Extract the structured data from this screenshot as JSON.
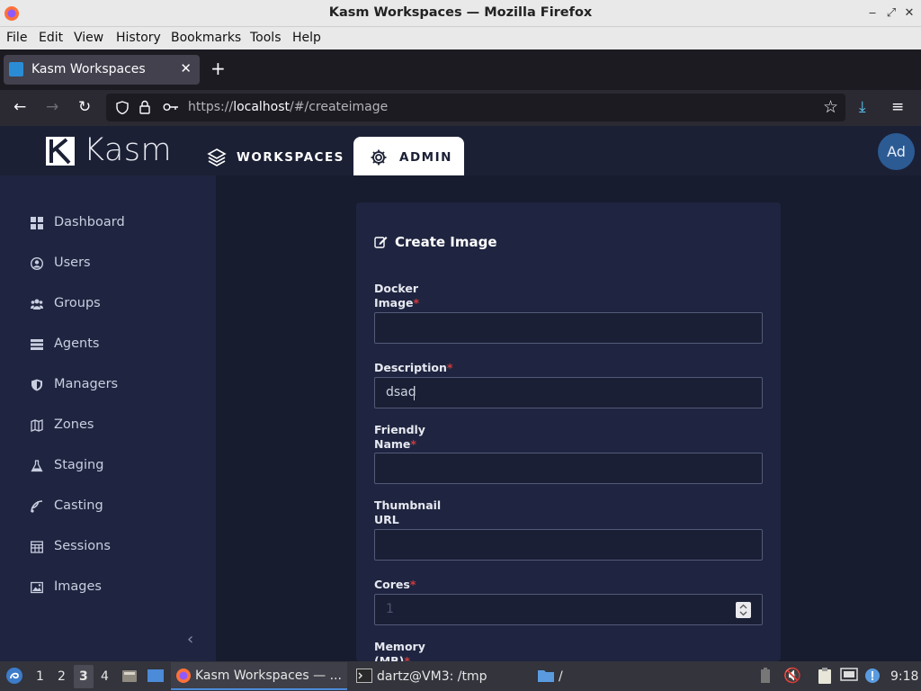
{
  "window": {
    "title": "Kasm Workspaces — Mozilla Firefox"
  },
  "menubar": {
    "items": [
      "File",
      "Edit",
      "View",
      "History",
      "Bookmarks",
      "Tools",
      "Help"
    ]
  },
  "browser": {
    "tab_title": "Kasm Workspaces",
    "url_prefix": "https://",
    "url_host": "localhost",
    "url_path": "/#/createimage"
  },
  "app": {
    "logo_text": "Kasm",
    "nav": {
      "workspaces": "WORKSPACES",
      "admin": "ADMIN"
    },
    "avatar_initials": "Ad",
    "sidebar": [
      {
        "label": "Dashboard",
        "icon": "dashboard-icon"
      },
      {
        "label": "Users",
        "icon": "user-circle-icon"
      },
      {
        "label": "Groups",
        "icon": "users-icon"
      },
      {
        "label": "Agents",
        "icon": "server-icon"
      },
      {
        "label": "Managers",
        "icon": "shield-icon"
      },
      {
        "label": "Zones",
        "icon": "map-icon"
      },
      {
        "label": "Staging",
        "icon": "flask-icon"
      },
      {
        "label": "Casting",
        "icon": "cast-icon"
      },
      {
        "label": "Sessions",
        "icon": "table-icon"
      },
      {
        "label": "Images",
        "icon": "image-icon"
      }
    ],
    "form": {
      "title": "Create Image",
      "docker_image_label_1": "Docker",
      "docker_image_label_2": "Image",
      "docker_image_value": "",
      "description_label": "Description",
      "description_value": "dsad",
      "friendly_name_label_1": "Friendly",
      "friendly_name_label_2": "Name",
      "friendly_name_value": "",
      "thumbnail_label_1": "Thumbnail",
      "thumbnail_label_2": "URL",
      "thumbnail_value": "",
      "cores_label": "Cores",
      "cores_placeholder": "1",
      "memory_label_1": "Memory",
      "memory_label_2": "(MB)",
      "required_mark": "*"
    }
  },
  "taskbar": {
    "workspaces": [
      "1",
      "2",
      "3",
      "4"
    ],
    "active_workspace": "3",
    "firefox_task": "Kasm Workspaces — ...",
    "terminal_task": "dartz@VM3: /tmp",
    "files_task": "/",
    "clock": "9:18"
  },
  "colors": {
    "app_bg": "#1b2035",
    "card_bg": "#1f2540",
    "required": "#d03b3b",
    "avatar": "#2c5b94"
  }
}
